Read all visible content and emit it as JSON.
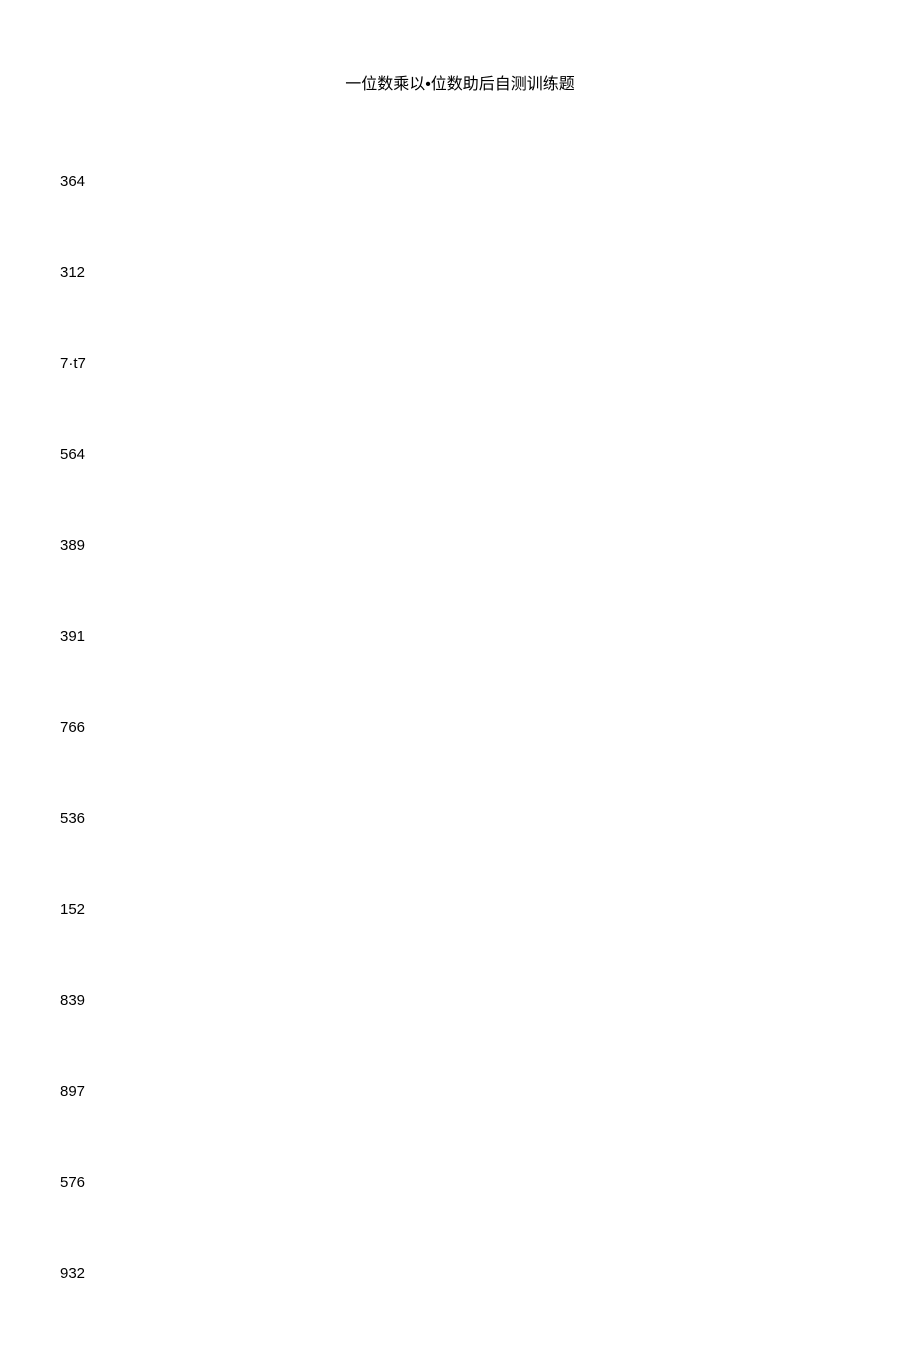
{
  "title": "一位数乘以•位数助后自测训练题",
  "items": [
    "364",
    "312",
    "7·t7",
    "564",
    "389",
    "391",
    "766",
    "536",
    "152",
    "839",
    "897",
    "576",
    "932"
  ]
}
